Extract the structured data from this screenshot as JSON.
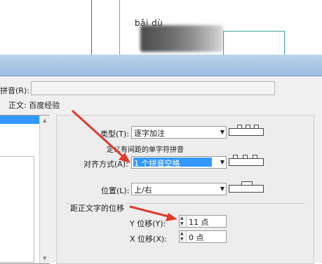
{
  "document": {
    "pinyin": "bǎi  dù"
  },
  "dialog": {
    "ruby_label": "拼音(R):",
    "body_text_label": "正文:",
    "body_text": "百度经验",
    "type": {
      "label": "类型(T):",
      "value": "逐字加注"
    },
    "hint": "定义有间距的单字符拼音",
    "alignment": {
      "label": "对齐方式(A):",
      "value": "1 个拼音空格"
    },
    "position": {
      "label": "位置(L):",
      "value": "上/右"
    },
    "offset_group": {
      "title": "距正文字的位移",
      "y_label": "Y 位移(Y):",
      "y_value": "11 点",
      "x_label": "X 位移(X):",
      "x_value": "0 点"
    }
  },
  "colors": {
    "selection": "#3399ff",
    "annotation_arrow": "#e03a2e",
    "titlebar": "#9bbbe0",
    "doc_teal": "#3aa39a",
    "doc_red_line": "#c0392b"
  },
  "icons": [
    "alignment-preview-icon",
    "spin-up-icon",
    "spin-down-icon",
    "dropdown-arrow-icon",
    "red-arrow-annotation"
  ]
}
